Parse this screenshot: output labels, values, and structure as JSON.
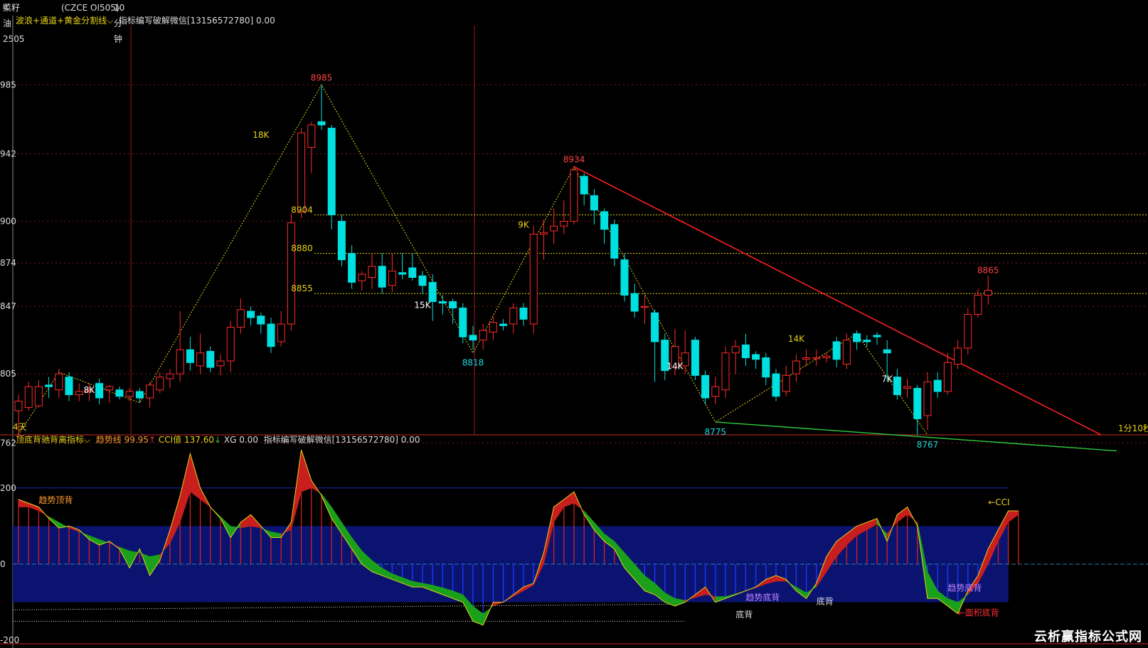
{
  "header": {
    "title": "菜籽油2505",
    "superscript": "M",
    "code": "(CZCE OI505)",
    "period": "10分钟"
  },
  "main_indicator": {
    "name": "波浪+通道+黄金分割线",
    "note": "指标编写破解微信[13156572780] 0.00"
  },
  "sub_indicator": {
    "name": "顶底背驰背离指标",
    "trend_label": "趋势线",
    "trend_value": "99.95",
    "cci_label": "CCI值",
    "cci_value": "137.60",
    "xg_label": "XG",
    "xg_value": "0.00",
    "note": "指标编写破解微信[13156572780] 0.00"
  },
  "labels": {
    "left_bottom": "4天",
    "right_countdown": "1分10秒",
    "watermark": "云析赢指标公式网"
  },
  "colors": {
    "up": "#ff2a2a",
    "down": "#00e0e0",
    "zigzag": "#e8d21a",
    "resistance": "#ff2020",
    "support": "#2ecc40",
    "cci_fill": "#0a1470"
  },
  "chart_data": [
    {
      "type": "candlestick",
      "ylim": [
        8762,
        8995
      ],
      "y_ticks": [
        {
          "value": 8985,
          "label": "985"
        },
        {
          "value": 8942,
          "label": "942"
        },
        {
          "value": 8900,
          "label": "900"
        },
        {
          "value": 8874,
          "label": "874"
        },
        {
          "value": 8847,
          "label": "847"
        },
        {
          "value": 8805,
          "label": "805"
        },
        {
          "value": 8762,
          "label": "762"
        }
      ],
      "candles": [
        {
          "o": 8782,
          "c": 8788,
          "h": 8792,
          "l": 8765
        },
        {
          "o": 8784,
          "c": 8797,
          "h": 8800,
          "l": 8782
        },
        {
          "o": 8785,
          "c": 8797,
          "h": 8801,
          "l": 8784
        },
        {
          "o": 8798,
          "c": 8797,
          "h": 8803,
          "l": 8790
        },
        {
          "o": 8795,
          "c": 8805,
          "h": 8808,
          "l": 8790
        },
        {
          "o": 8803,
          "c": 8792,
          "h": 8806,
          "l": 8788
        },
        {
          "o": 8792,
          "c": 8794,
          "h": 8799,
          "l": 8788
        },
        {
          "o": 8794,
          "c": 8795,
          "h": 8799,
          "l": 8788
        },
        {
          "o": 8799,
          "c": 8790,
          "h": 8802,
          "l": 8786
        },
        {
          "o": 8795,
          "c": 8797,
          "h": 8798,
          "l": 8787
        },
        {
          "o": 8795,
          "c": 8791,
          "h": 8797,
          "l": 8789
        },
        {
          "o": 8791,
          "c": 8794,
          "h": 8796,
          "l": 8788
        },
        {
          "o": 8794,
          "c": 8790,
          "h": 8796,
          "l": 8787
        },
        {
          "o": 8790,
          "c": 8798,
          "h": 8800,
          "l": 8784
        },
        {
          "o": 8795,
          "c": 8803,
          "h": 8806,
          "l": 8793
        },
        {
          "o": 8802,
          "c": 8805,
          "h": 8808,
          "l": 8796
        },
        {
          "o": 8805,
          "c": 8820,
          "h": 8844,
          "l": 8800
        },
        {
          "o": 8820,
          "c": 8812,
          "h": 8828,
          "l": 8807
        },
        {
          "o": 8810,
          "c": 8818,
          "h": 8830,
          "l": 8805
        },
        {
          "o": 8819,
          "c": 8809,
          "h": 8822,
          "l": 8806
        },
        {
          "o": 8810,
          "c": 8813,
          "h": 8817,
          "l": 8804
        },
        {
          "o": 8813,
          "c": 8834,
          "h": 8838,
          "l": 8806
        },
        {
          "o": 8834,
          "c": 8845,
          "h": 8852,
          "l": 8830
        },
        {
          "o": 8844,
          "c": 8840,
          "h": 8847,
          "l": 8835
        },
        {
          "o": 8841,
          "c": 8836,
          "h": 8843,
          "l": 8830
        },
        {
          "o": 8836,
          "c": 8822,
          "h": 8840,
          "l": 8818
        },
        {
          "o": 8825,
          "c": 8836,
          "h": 8844,
          "l": 8822
        },
        {
          "o": 8836,
          "c": 8899,
          "h": 8905,
          "l": 8832
        },
        {
          "o": 8906,
          "c": 8955,
          "h": 8958,
          "l": 8902
        },
        {
          "o": 8946,
          "c": 8960,
          "h": 8962,
          "l": 8930
        },
        {
          "o": 8962,
          "c": 8960,
          "h": 8985,
          "l": 8957
        },
        {
          "o": 8958,
          "c": 8904,
          "h": 8960,
          "l": 8895
        },
        {
          "o": 8900,
          "c": 8876,
          "h": 8904,
          "l": 8872
        },
        {
          "o": 8880,
          "c": 8862,
          "h": 8885,
          "l": 8858
        },
        {
          "o": 8863,
          "c": 8867,
          "h": 8869,
          "l": 8857
        },
        {
          "o": 8865,
          "c": 8872,
          "h": 8880,
          "l": 8858
        },
        {
          "o": 8872,
          "c": 8859,
          "h": 8880,
          "l": 8855
        },
        {
          "o": 8860,
          "c": 8869,
          "h": 8880,
          "l": 8856
        },
        {
          "o": 8868,
          "c": 8867,
          "h": 8880,
          "l": 8864
        },
        {
          "o": 8871,
          "c": 8865,
          "h": 8880,
          "l": 8863
        },
        {
          "o": 8866,
          "c": 8860,
          "h": 8869,
          "l": 8855
        },
        {
          "o": 8862,
          "c": 8850,
          "h": 8867,
          "l": 8838
        },
        {
          "o": 8850,
          "c": 8849,
          "h": 8854,
          "l": 8842
        },
        {
          "o": 8850,
          "c": 8846,
          "h": 8852,
          "l": 8836
        },
        {
          "o": 8846,
          "c": 8828,
          "h": 8849,
          "l": 8824
        },
        {
          "o": 8829,
          "c": 8826,
          "h": 8835,
          "l": 8820
        },
        {
          "o": 8826,
          "c": 8832,
          "h": 8836,
          "l": 8820
        },
        {
          "o": 8831,
          "c": 8837,
          "h": 8841,
          "l": 8826
        },
        {
          "o": 8836,
          "c": 8835,
          "h": 8839,
          "l": 8832
        },
        {
          "o": 8836,
          "c": 8846,
          "h": 8849,
          "l": 8830
        },
        {
          "o": 8846,
          "c": 8839,
          "h": 8849,
          "l": 8835
        },
        {
          "o": 8836,
          "c": 8892,
          "h": 8897,
          "l": 8830
        },
        {
          "o": 8892,
          "c": 8893,
          "h": 8901,
          "l": 8876
        },
        {
          "o": 8894,
          "c": 8897,
          "h": 8908,
          "l": 8886
        },
        {
          "o": 8897,
          "c": 8900,
          "h": 8913,
          "l": 8892
        },
        {
          "o": 8900,
          "c": 8932,
          "h": 8934,
          "l": 8898
        },
        {
          "o": 8928,
          "c": 8917,
          "h": 8930,
          "l": 8910
        },
        {
          "o": 8916,
          "c": 8907,
          "h": 8920,
          "l": 8898
        },
        {
          "o": 8906,
          "c": 8895,
          "h": 8908,
          "l": 8886
        },
        {
          "o": 8898,
          "c": 8877,
          "h": 8901,
          "l": 8872
        },
        {
          "o": 8876,
          "c": 8854,
          "h": 8880,
          "l": 8850
        },
        {
          "o": 8855,
          "c": 8844,
          "h": 8861,
          "l": 8840
        },
        {
          "o": 8847,
          "c": 8847,
          "h": 8854,
          "l": 8836
        },
        {
          "o": 8843,
          "c": 8825,
          "h": 8845,
          "l": 8800
        },
        {
          "o": 8826,
          "c": 8807,
          "h": 8830,
          "l": 8801
        },
        {
          "o": 8809,
          "c": 8822,
          "h": 8833,
          "l": 8804
        },
        {
          "o": 8810,
          "c": 8818,
          "h": 8832,
          "l": 8805
        },
        {
          "o": 8826,
          "c": 8804,
          "h": 8828,
          "l": 8801
        },
        {
          "o": 8804,
          "c": 8790,
          "h": 8807,
          "l": 8786
        },
        {
          "o": 8791,
          "c": 8797,
          "h": 8803,
          "l": 8786
        },
        {
          "o": 8795,
          "c": 8818,
          "h": 8822,
          "l": 8790
        },
        {
          "o": 8818,
          "c": 8822,
          "h": 8826,
          "l": 8805
        },
        {
          "o": 8823,
          "c": 8815,
          "h": 8830,
          "l": 8810
        },
        {
          "o": 8817,
          "c": 8814,
          "h": 8819,
          "l": 8808
        },
        {
          "o": 8815,
          "c": 8803,
          "h": 8818,
          "l": 8798
        },
        {
          "o": 8805,
          "c": 8791,
          "h": 8808,
          "l": 8788
        },
        {
          "o": 8794,
          "c": 8804,
          "h": 8810,
          "l": 8791
        },
        {
          "o": 8805,
          "c": 8813,
          "h": 8817,
          "l": 8800
        },
        {
          "o": 8814,
          "c": 8815,
          "h": 8820,
          "l": 8810
        },
        {
          "o": 8815,
          "c": 8815,
          "h": 8820,
          "l": 8810
        },
        {
          "o": 8815,
          "c": 8816,
          "h": 8818,
          "l": 8812
        },
        {
          "o": 8825,
          "c": 8814,
          "h": 8828,
          "l": 8809
        },
        {
          "o": 8811,
          "c": 8826,
          "h": 8830,
          "l": 8808
        },
        {
          "o": 8830,
          "c": 8825,
          "h": 8832,
          "l": 8820
        },
        {
          "o": 8826,
          "c": 8825,
          "h": 8829,
          "l": 8822
        },
        {
          "o": 8829,
          "c": 8828,
          "h": 8831,
          "l": 8823
        },
        {
          "o": 8820,
          "c": 8818,
          "h": 8826,
          "l": 8800
        },
        {
          "o": 8803,
          "c": 8792,
          "h": 8808,
          "l": 8789
        },
        {
          "o": 8796,
          "c": 8797,
          "h": 8802,
          "l": 8790
        },
        {
          "o": 8796,
          "c": 8777,
          "h": 8798,
          "l": 8767
        },
        {
          "o": 8779,
          "c": 8800,
          "h": 8806,
          "l": 8770
        },
        {
          "o": 8801,
          "c": 8794,
          "h": 8806,
          "l": 8790
        },
        {
          "o": 8794,
          "c": 8812,
          "h": 8818,
          "l": 8792
        },
        {
          "o": 8811,
          "c": 8821,
          "h": 8826,
          "l": 8808
        },
        {
          "o": 8821,
          "c": 8842,
          "h": 8846,
          "l": 8817
        },
        {
          "o": 8842,
          "c": 8854,
          "h": 8858,
          "l": 8840
        },
        {
          "o": 8854,
          "c": 8857,
          "h": 8866,
          "l": 8848
        }
      ],
      "point_labels": [
        {
          "i": 30,
          "price": 8985,
          "text": "8985",
          "pos": "top"
        },
        {
          "i": 55,
          "price": 8934,
          "text": "8934",
          "pos": "top"
        },
        {
          "i": 45,
          "price": 8818,
          "text": "8818",
          "pos": "bottom"
        },
        {
          "i": 69,
          "price": 8775,
          "text": "8775",
          "pos": "bottom"
        },
        {
          "i": 90,
          "price": 8767,
          "text": "8767",
          "pos": "bottom"
        },
        {
          "i": 96,
          "price": 8865,
          "text": "8865",
          "pos": "top"
        }
      ],
      "zigzag": [
        {
          "i": 0,
          "p": 8767
        },
        {
          "i": 4,
          "p": 8806
        },
        {
          "i": 12,
          "p": 8787
        },
        {
          "i": 30,
          "p": 8985
        },
        {
          "i": 45,
          "p": 8818
        },
        {
          "i": 55,
          "p": 8934
        },
        {
          "i": 69,
          "p": 8775
        },
        {
          "i": 83,
          "p": 8830
        },
        {
          "i": 90,
          "p": 8767
        }
      ],
      "wave_labels": [
        {
          "i": 7,
          "p": 8793,
          "text": "8K"
        },
        {
          "i": 24,
          "p": 8952,
          "text": "18K"
        },
        {
          "i": 40,
          "p": 8846,
          "text": "15K"
        },
        {
          "i": 50,
          "p": 8896,
          "text": "9K"
        },
        {
          "i": 65,
          "p": 8808,
          "text": "14K"
        },
        {
          "i": 77,
          "p": 8825,
          "text": "14K"
        },
        {
          "i": 86,
          "p": 8800,
          "text": "7K"
        }
      ],
      "levels": [
        {
          "value": 8904,
          "label": "8904"
        },
        {
          "value": 8880,
          "label": "8880"
        },
        {
          "value": 8855,
          "label": "8855"
        }
      ],
      "vertical_lines": [
        11,
        45
      ]
    },
    {
      "type": "area",
      "name": "CCI",
      "ylim": [
        -200,
        300
      ],
      "y_ticks": [
        {
          "value": 200,
          "label": "200"
        },
        {
          "value": 0,
          "label": "0"
        },
        {
          "value": -200,
          "label": "-200"
        }
      ],
      "band": [
        -100,
        100
      ],
      "cci": [
        170,
        160,
        150,
        120,
        95,
        100,
        90,
        65,
        50,
        60,
        40,
        -10,
        40,
        -30,
        10,
        90,
        180,
        290,
        200,
        150,
        120,
        70,
        110,
        130,
        100,
        70,
        70,
        110,
        300,
        220,
        180,
        120,
        80,
        40,
        0,
        -20,
        -30,
        -40,
        -50,
        -60,
        -60,
        -70,
        -80,
        -90,
        -100,
        -150,
        -160,
        -100,
        -100,
        -80,
        -60,
        -50,
        30,
        150,
        170,
        190,
        130,
        90,
        60,
        40,
        -10,
        -40,
        -70,
        -80,
        -100,
        -110,
        -100,
        -80,
        -60,
        -100,
        -90,
        -80,
        -70,
        -60,
        -40,
        -30,
        -40,
        -70,
        -90,
        -50,
        20,
        60,
        80,
        100,
        110,
        120,
        60,
        130,
        150,
        100,
        -90,
        -90,
        -110,
        -130,
        -70,
        -30,
        40,
        90,
        140,
        140
      ],
      "trend": [
        150,
        150,
        140,
        125,
        110,
        95,
        85,
        75,
        65,
        55,
        45,
        35,
        30,
        20,
        25,
        55,
        110,
        190,
        170,
        150,
        125,
        100,
        95,
        100,
        95,
        85,
        80,
        90,
        190,
        200,
        185,
        150,
        110,
        70,
        35,
        10,
        -10,
        -25,
        -35,
        -45,
        -50,
        -55,
        -62,
        -70,
        -80,
        -110,
        -130,
        -110,
        -100,
        -85,
        -70,
        -55,
        0,
        110,
        150,
        160,
        140,
        110,
        80,
        60,
        30,
        0,
        -30,
        -50,
        -75,
        -90,
        -95,
        -88,
        -80,
        -85,
        -85,
        -78,
        -70,
        -62,
        -52,
        -45,
        -45,
        -60,
        -75,
        -60,
        -20,
        20,
        50,
        75,
        90,
        105,
        80,
        110,
        130,
        110,
        -20,
        -70,
        -90,
        -100,
        -80,
        -50,
        0,
        60,
        110,
        130
      ],
      "annotations": [
        {
          "i": 2,
          "v": 160,
          "text": "趋势顶背",
          "color": "#ff9b2e"
        },
        {
          "i": 72,
          "v": -95,
          "text": "趋势底背",
          "color": "#c080ff"
        },
        {
          "i": 71,
          "v": -140,
          "text": "底背",
          "color": "#dddddd"
        },
        {
          "i": 79,
          "v": -105,
          "text": "底背",
          "color": "#dddddd"
        },
        {
          "i": 92,
          "v": -70,
          "text": "趋势底背",
          "color": "#c080ff"
        },
        {
          "i": 93,
          "v": -135,
          "text": "←面积底背",
          "color": "#ff3030"
        },
        {
          "i": 96,
          "v": 155,
          "text": "←CCI",
          "color": "#e8d21a"
        }
      ]
    }
  ]
}
